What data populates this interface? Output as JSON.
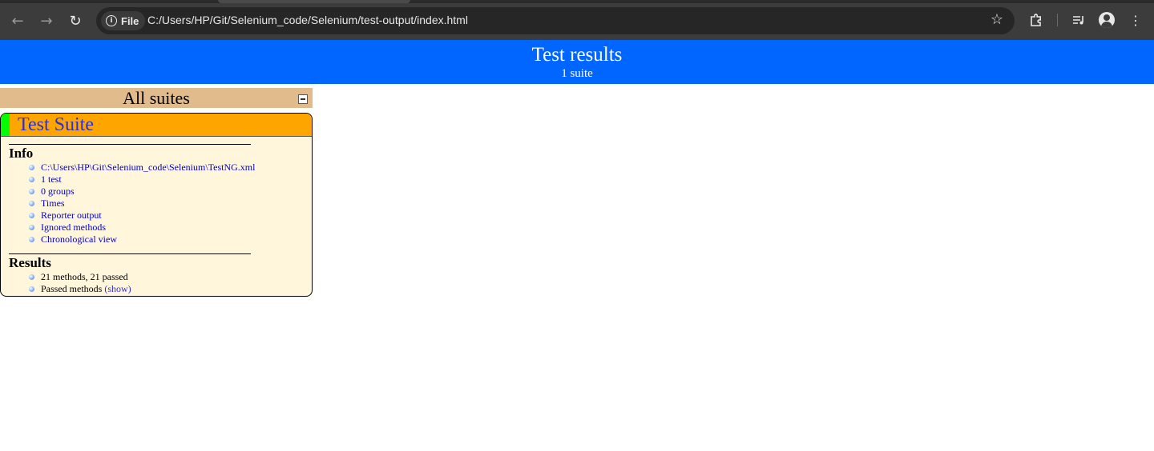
{
  "browser": {
    "file_chip_label": "File",
    "url": "C:/Users/HP/Git/Selenium_code/Selenium/test-output/index.html",
    "icons": {
      "back": "arrow-left",
      "forward": "arrow-right",
      "reload": "reload",
      "info": "info",
      "star": "star",
      "extensions": "puzzle-piece",
      "media": "media-queue",
      "profile": "person",
      "menu": "three-dots-vertical"
    }
  },
  "header": {
    "title": "Test results",
    "subtitle": "1 suite",
    "color": "#0066ff"
  },
  "suites_bar": {
    "title": "All suites",
    "color": "#e2bb8c"
  },
  "suite": {
    "name": "Test Suite",
    "header_color": "#ffa500",
    "status_color": "#00ff00",
    "info": {
      "title": "Info",
      "items": [
        "C:\\Users\\HP\\Git\\Selenium_code\\Selenium\\TestNG.xml",
        "1 test",
        "0 groups",
        "Times",
        "Reporter output",
        "Ignored methods",
        "Chronological view"
      ]
    },
    "results": {
      "title": "Results",
      "summary": "21 methods, 21 passed",
      "passed_label": "Passed methods",
      "show_label": "(show)"
    }
  }
}
